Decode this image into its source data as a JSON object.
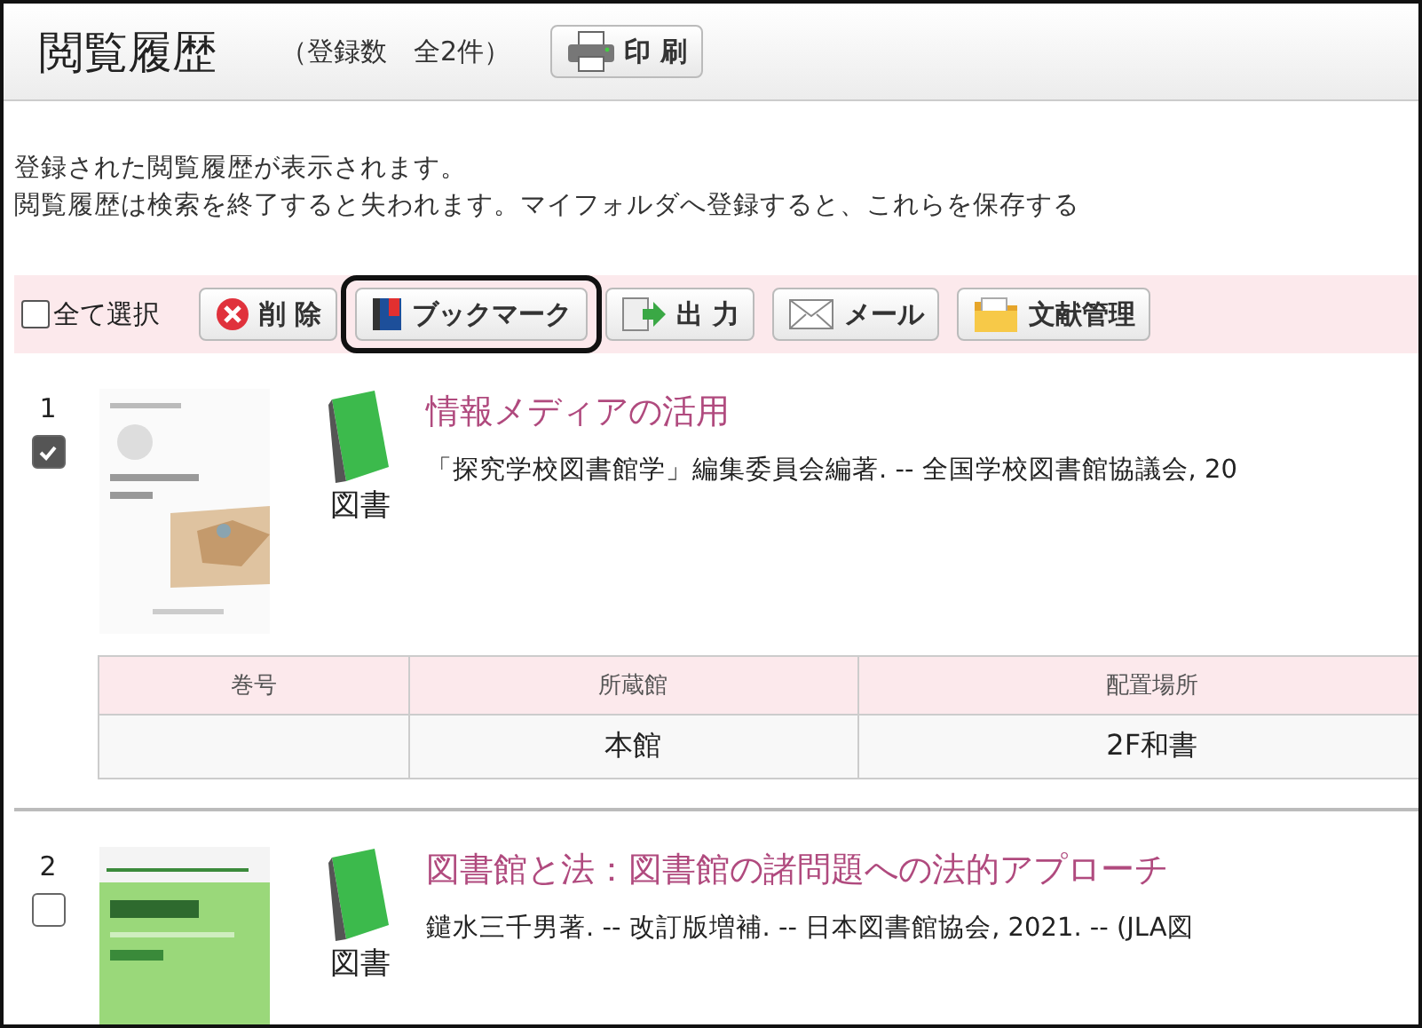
{
  "header": {
    "title": "閲覧履歴",
    "count": "（登録数　全2件）",
    "print_button": "印 刷"
  },
  "intro": [
    "登録された閲覧履歴が表示されます。",
    "閲覧履歴は検索を終了すると失われます。マイフォルダへ登録すると、これらを保存する"
  ],
  "toolbar": {
    "select_all": {
      "label": "全て選択",
      "checked": false
    },
    "buttons": [
      {
        "kind": "delete",
        "label": "削 除",
        "highlighted": false
      },
      {
        "kind": "bookmark",
        "label": "ブックマーク",
        "highlighted": true
      },
      {
        "kind": "export",
        "label": "出 力",
        "highlighted": false
      },
      {
        "kind": "mail",
        "label": "メール",
        "highlighted": false
      },
      {
        "kind": "folder",
        "label": "文献管理",
        "highlighted": false
      }
    ]
  },
  "records": [
    {
      "number": "1",
      "checked": true,
      "type": "図書",
      "title": "情報メディアの活用",
      "description": "「探究学校図書館学」編集委員会編著. -- 全国学校図書館協議会, 20",
      "holdings": {
        "columns": [
          "巻号",
          "所蔵館",
          "配置場所"
        ],
        "rows": [
          [
            "",
            "本館",
            "2F和書"
          ]
        ]
      }
    },
    {
      "number": "2",
      "checked": false,
      "type": "図書",
      "title": "図書館と法：図書館の諸問題への法的アプローチ",
      "description": "鑓水三千男著. -- 改訂版増補. -- 日本図書館協会, 2021. -- (JLA図"
    }
  ]
}
